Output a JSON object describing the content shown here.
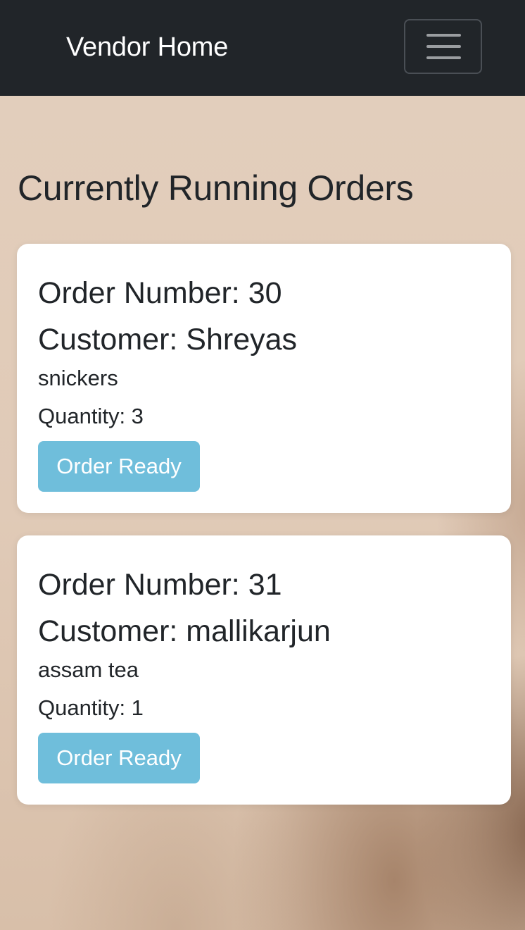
{
  "navbar": {
    "brand": "Vendor Home",
    "menu_icon": "hamburger-menu-icon"
  },
  "page": {
    "title": "Currently Running Orders"
  },
  "orders": [
    {
      "order_number": "Order Number: 30",
      "customer": "Customer: Shreyas",
      "item": "snickers",
      "quantity": "Quantity: 3",
      "button_label": "Order Ready"
    },
    {
      "order_number": "Order Number: 31",
      "customer": "Customer: mallikarjun",
      "item": "assam tea",
      "quantity": "Quantity: 1",
      "button_label": "Order Ready"
    }
  ],
  "colors": {
    "navbar_bg": "#212529",
    "button_bg": "#6fbedb",
    "card_bg": "#ffffff",
    "page_bg": "#e2cdbb"
  }
}
